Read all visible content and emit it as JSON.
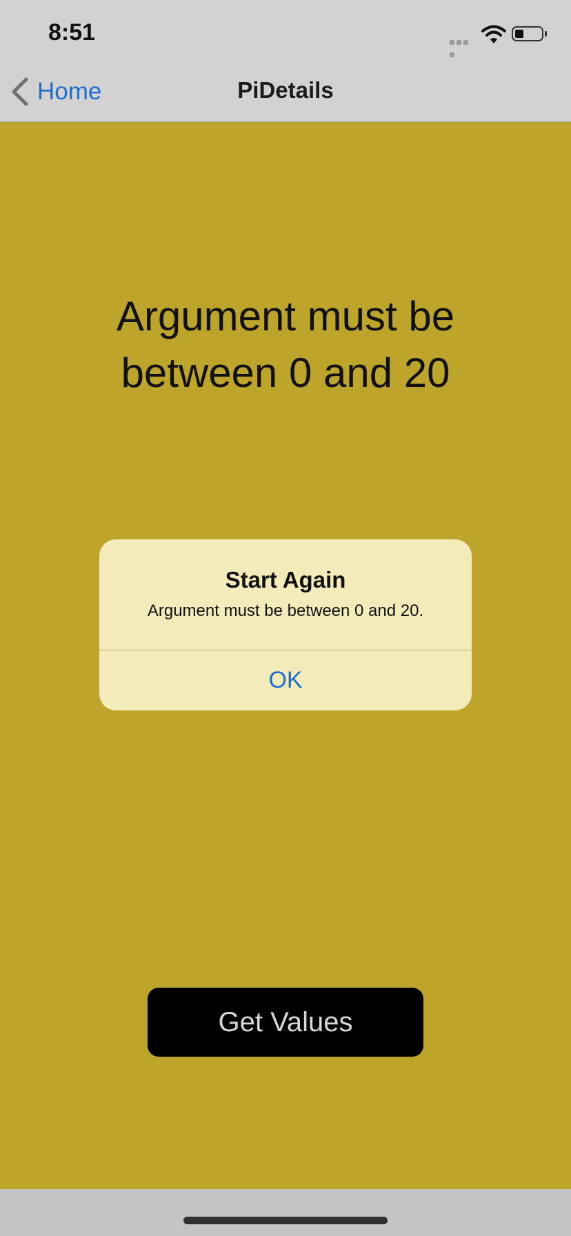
{
  "status_bar": {
    "time": "8:51",
    "icons": [
      "signal-icon",
      "wifi-icon",
      "battery-icon"
    ]
  },
  "nav": {
    "back_label": "Home",
    "title": "PiDetails"
  },
  "main": {
    "message": "Argument must be between 0 and 20"
  },
  "alert": {
    "title": "Start Again",
    "message": "Argument must be between 0 and 20.",
    "ok_label": "OK"
  },
  "button": {
    "label": "Get Values"
  },
  "colors": {
    "background": "#bda42a",
    "bar": "#d2d2d2",
    "accent": "#1a6fd1",
    "alert_bg": "#f4ebbb",
    "button_bg": "#000000"
  }
}
